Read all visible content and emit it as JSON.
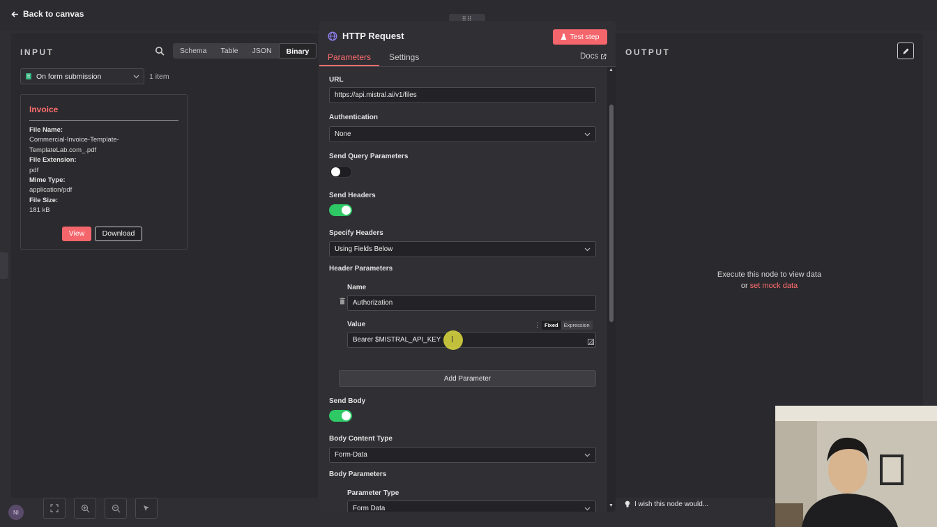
{
  "topbar": {
    "back_label": "Back to canvas"
  },
  "input": {
    "title": "INPUT",
    "view_tabs": [
      "Schema",
      "Table",
      "JSON",
      "Binary"
    ],
    "active_view": "Binary",
    "node_select": "On form submission",
    "items_count": "1 item",
    "card": {
      "title": "Invoice",
      "file_name_label": "File Name:",
      "file_name_line1": "Commercial-Invoice-Template-",
      "file_name_line2": "TemplateLab.com_.pdf",
      "ext_label": "File Extension:",
      "ext_value": "pdf",
      "mime_label": "Mime Type:",
      "mime_value": "application/pdf",
      "size_label": "File Size:",
      "size_value": "181 kB",
      "view_btn": "View",
      "download_btn": "Download"
    }
  },
  "modal": {
    "title": "HTTP Request",
    "test_btn": "Test step",
    "tabs": [
      "Parameters",
      "Settings"
    ],
    "docs": "Docs",
    "url_label": "URL",
    "url_value": "https://api.mistral.ai/v1/files",
    "auth_label": "Authentication",
    "auth_value": "None",
    "query_label": "Send Query Parameters",
    "query_on": false,
    "headers_label": "Send Headers",
    "headers_on": true,
    "specify_headers_label": "Specify Headers",
    "specify_headers_value": "Using Fields Below",
    "header_params_label": "Header Parameters",
    "name_label": "Name",
    "name_value": "Authorization",
    "value_label": "Value",
    "value_modes": [
      "Fixed",
      "Expression"
    ],
    "value_value": "Bearer $MISTRAL_API_KEY",
    "add_param": "Add Parameter",
    "body_label": "Send Body",
    "body_on": true,
    "content_type_label": "Body Content Type",
    "content_type_value": "Form-Data",
    "body_params_label": "Body Parameters",
    "param_type_label": "Parameter Type",
    "param_type_value": "Form Data"
  },
  "output": {
    "title": "OUTPUT",
    "exec_line1": "Execute this node to view data",
    "exec_or": "or",
    "mock_link": "set mock data"
  },
  "footer": {
    "wish": "I wish this node would..."
  },
  "colors": {
    "accent": "#ff6d6d",
    "toggle_on": "#2ec865",
    "panel": "#2a2a2e"
  }
}
